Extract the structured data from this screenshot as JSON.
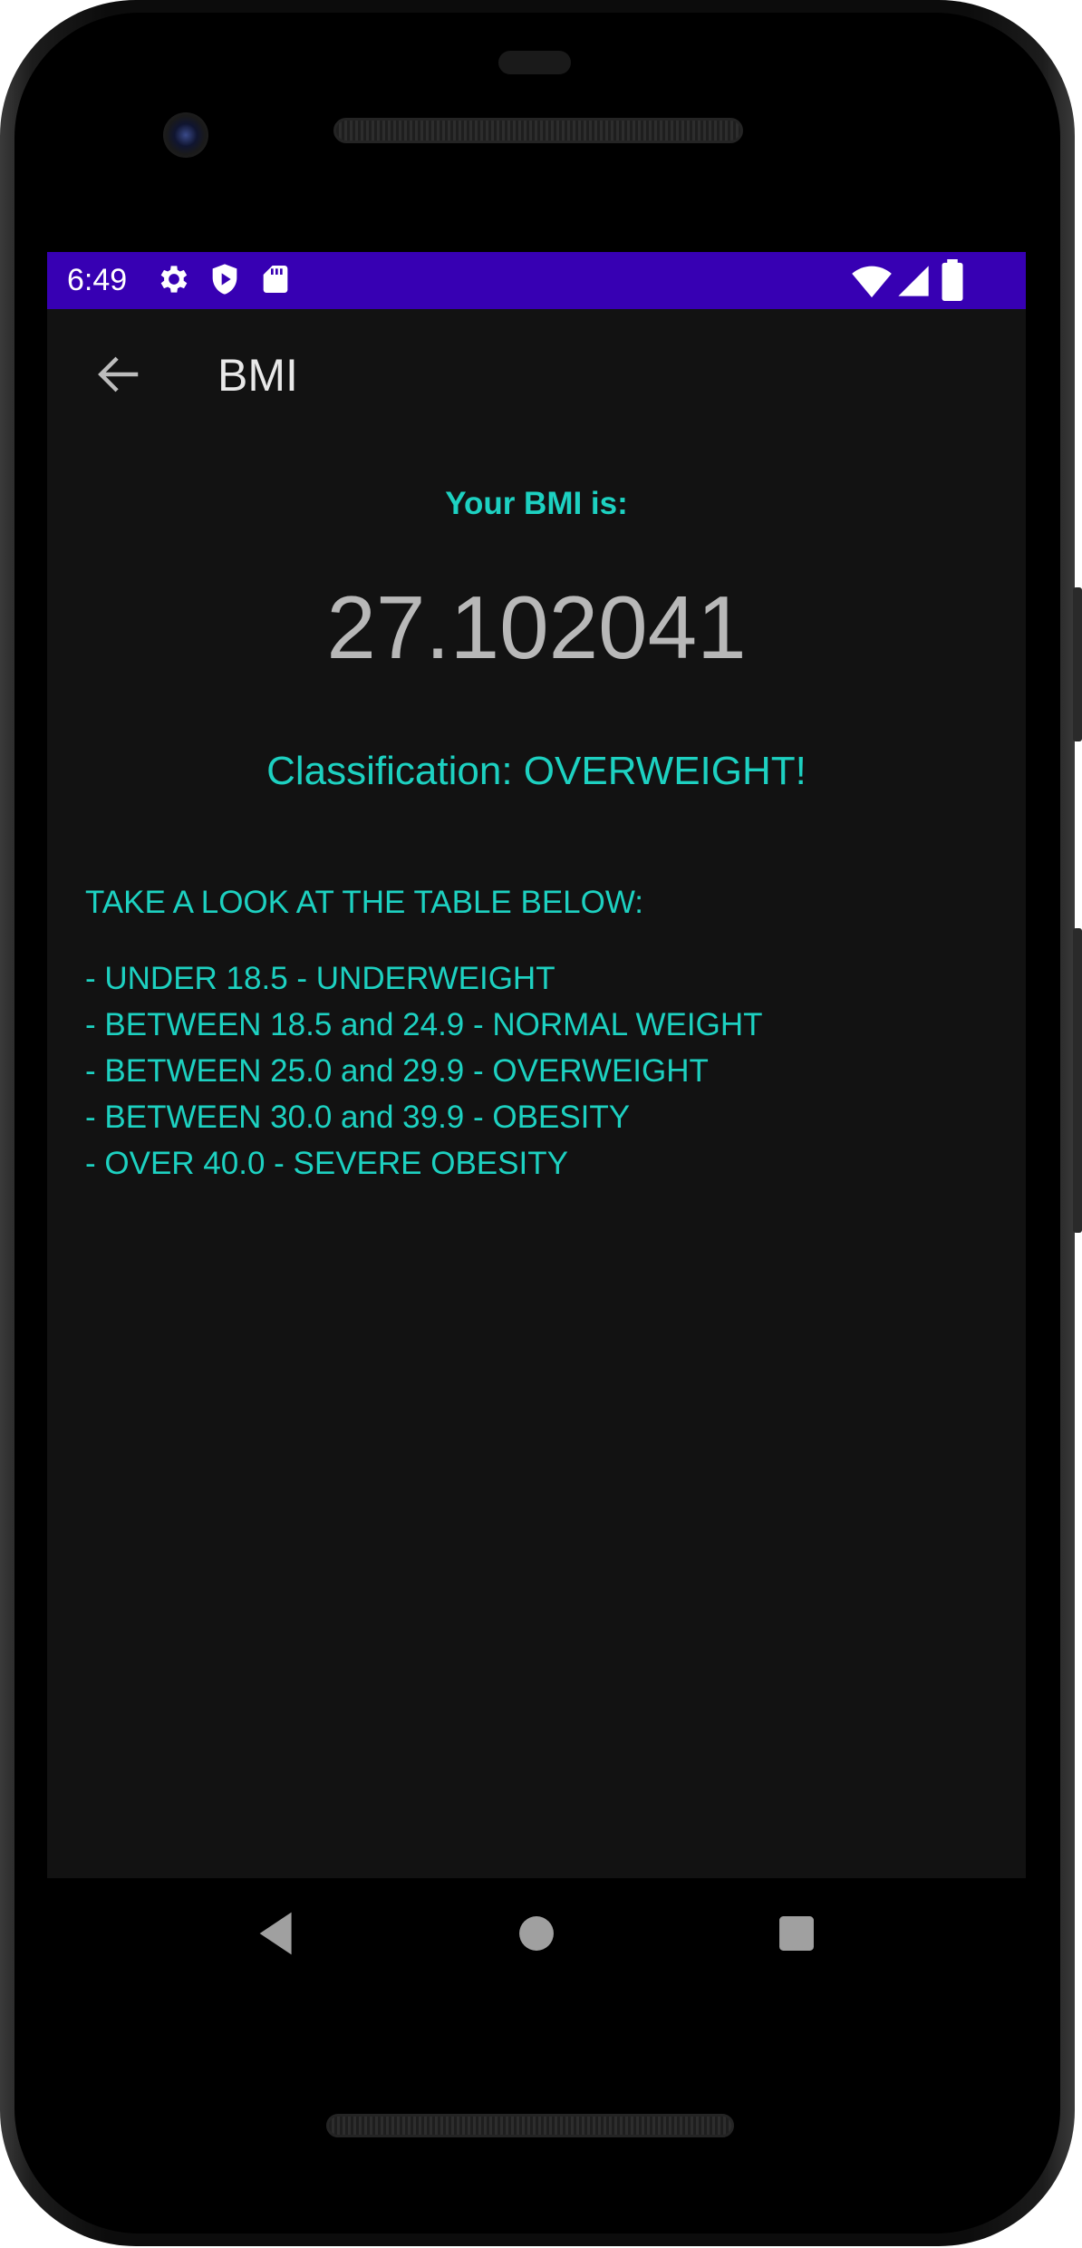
{
  "status_bar": {
    "time": "6:49",
    "background": "#3700b3",
    "left_icons": [
      "gear-icon",
      "shield-play-icon",
      "sd-card-icon"
    ],
    "right_icons": [
      "wifi-icon",
      "signal-icon",
      "battery-icon"
    ]
  },
  "app_bar": {
    "back_icon": "arrow-left-icon",
    "title": "BMI"
  },
  "result": {
    "label": "Your BMI is:",
    "value": "27.102041",
    "classification": "Classification: OVERWEIGHT!"
  },
  "table": {
    "title": "TAKE A LOOK AT THE TABLE BELOW:",
    "rows": [
      "- UNDER 18.5 - UNDERWEIGHT",
      "- BETWEEN 18.5 and 24.9 - NORMAL WEIGHT",
      "- BETWEEN 25.0 and 29.9 - OVERWEIGHT",
      "- BETWEEN 30.0 and 39.9 - OBESITY",
      "- OVER 40.0 - SEVERE OBESITY"
    ]
  },
  "nav_bar": {
    "buttons": [
      "back-triangle-icon",
      "home-circle-icon",
      "recents-square-icon"
    ]
  },
  "colors": {
    "accent": "#1dd1c1",
    "screen_background": "#121212",
    "value_text": "#b8b8b8"
  }
}
